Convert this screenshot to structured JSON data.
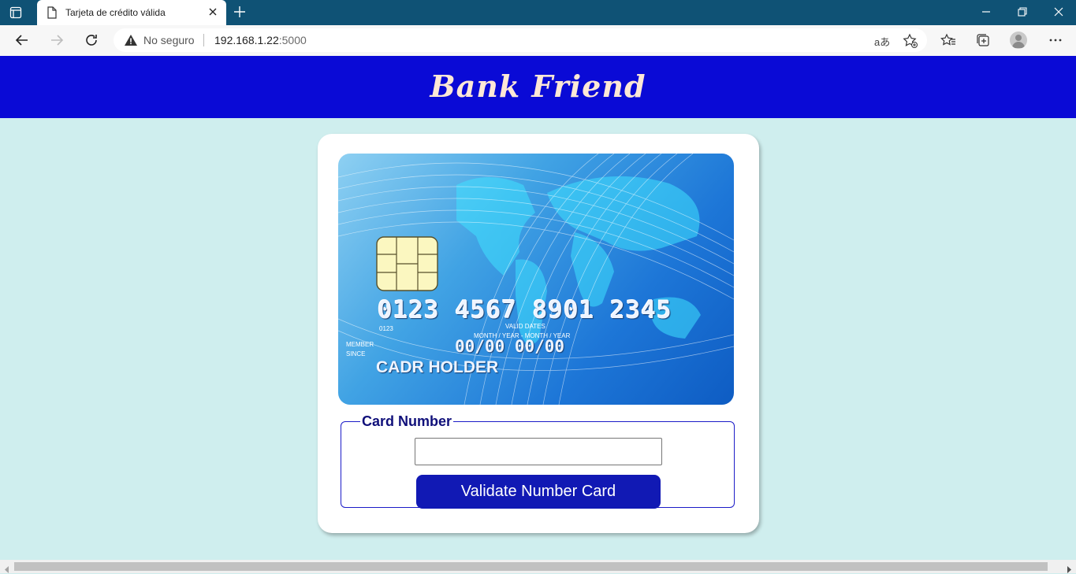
{
  "browser": {
    "tab_title": "Tarjeta de crédito válida",
    "security_label": "No seguro",
    "url_host": "192.168.1.22",
    "url_port": ":5000",
    "read_aloud_glyph": "aあ"
  },
  "header": {
    "brand": "Bank Friend"
  },
  "card": {
    "number": "0123 4567 8901 2345",
    "small_number": "0123",
    "valid_dates_label": "VALID DATES",
    "month_year_label": "MONTH / YEAR - MONTH / YEAR",
    "dates": "00/00  00/00",
    "member_label": "MEMBER",
    "since_label": "SINCE",
    "holder": "CADR HOLDER"
  },
  "form": {
    "legend": "Card Number",
    "input_value": "",
    "button_label": "Validate Number Card"
  },
  "colors": {
    "header_bg": "#0a0ad6",
    "page_bg": "#cfeeee",
    "button_bg": "#1119b4",
    "tabbar_bg": "#0f5275"
  }
}
